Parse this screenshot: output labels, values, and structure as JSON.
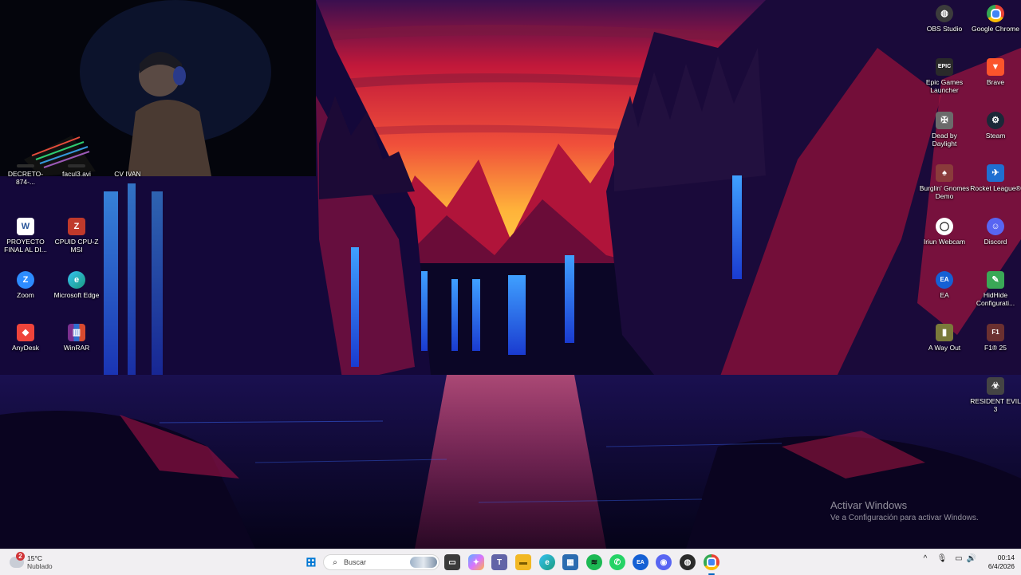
{
  "desktop": {
    "left_icons": [
      {
        "label": "DECRETO-874-...",
        "icon": "document-icon",
        "color": "#2d2d2d"
      },
      {
        "label": "facul3.avi",
        "icon": "video-file-icon",
        "color": "#2d2d2d"
      },
      {
        "label": "CV IVAN",
        "icon": "folder-icon",
        "color": "#2d2d2d"
      },
      {
        "label": "PROYECTO FINAL AL DI...",
        "icon": "word-document-icon",
        "color": "#2b579a"
      },
      {
        "label": "CPUID CPU-Z MSI",
        "icon": "cpuz-icon",
        "color": "#c0392b"
      },
      {
        "label": "Zoom",
        "icon": "zoom-icon",
        "color": "#2d8cff"
      },
      {
        "label": "Microsoft Edge",
        "icon": "edge-icon",
        "color": "#1a9c7f"
      },
      {
        "label": "AnyDesk",
        "icon": "anydesk-icon",
        "color": "#ef443b"
      },
      {
        "label": "WinRAR",
        "icon": "winrar-icon",
        "color": "#7b2f8f"
      }
    ],
    "right_icons": [
      {
        "label": "OBS Studio",
        "icon": "obs-icon",
        "color": "#3c3c3c"
      },
      {
        "label": "Google Chrome",
        "icon": "chrome-icon",
        "color": "#ea4335"
      },
      {
        "label": "Epic Games Launcher",
        "icon": "epic-games-icon",
        "color": "#2a2a2a"
      },
      {
        "label": "Brave",
        "icon": "brave-icon",
        "color": "#fb542b"
      },
      {
        "label": "Dead by Daylight",
        "icon": "dead-by-daylight-icon",
        "color": "#6b6b6b"
      },
      {
        "label": "Steam",
        "icon": "steam-icon",
        "color": "#1b2838"
      },
      {
        "label": "Burglin' Gnomes Demo",
        "icon": "burglin-gnomes-icon",
        "color": "#8a3b3b"
      },
      {
        "label": "Rocket League®",
        "icon": "rocket-league-icon",
        "color": "#1f6fd1"
      },
      {
        "label": "Iriun Webcam",
        "icon": "iriun-webcam-icon",
        "color": "#1e1e1e"
      },
      {
        "label": "Discord",
        "icon": "discord-icon",
        "color": "#5865f2"
      },
      {
        "label": "EA",
        "icon": "ea-icon",
        "color": "#1560d4"
      },
      {
        "label": "HidHide Configurati...",
        "icon": "hidhide-icon",
        "color": "#3aa856"
      },
      {
        "label": "A Way Out",
        "icon": "a-way-out-icon",
        "color": "#7a7a3a"
      },
      {
        "label": "F1® 25",
        "icon": "f1-25-icon",
        "color": "#6b3030"
      },
      {
        "label": "RESIDENT EVIL 3",
        "icon": "resident-evil-3-icon",
        "color": "#444444"
      }
    ]
  },
  "watermark": {
    "title": "Activar Windows",
    "subtitle": "Ve a Configuración para activar Windows."
  },
  "taskbar": {
    "weather": {
      "temp": "15°C",
      "condition": "Nublado",
      "badge": "2"
    },
    "search_placeholder": "Buscar",
    "pinned": [
      {
        "name": "windows-start-icon",
        "glyph": "⊞",
        "color": "#0078d4"
      },
      {
        "name": "task-view-icon",
        "glyph": "▭",
        "color": "#3b3b3b"
      },
      {
        "name": "copilot-icon",
        "glyph": "✦",
        "color": "#d874ff"
      },
      {
        "name": "teams-icon",
        "glyph": "T",
        "color": "#6264a7"
      },
      {
        "name": "file-explorer-icon",
        "glyph": "▬",
        "color": "#f2b824"
      },
      {
        "name": "edge-icon",
        "glyph": "e",
        "color": "#1a9c7f"
      },
      {
        "name": "microsoft-store-icon",
        "glyph": "▦",
        "color": "#2b6cb0"
      },
      {
        "name": "spotify-icon",
        "glyph": "≋",
        "color": "#1db954"
      },
      {
        "name": "whatsapp-icon",
        "glyph": "✆",
        "color": "#25d366"
      },
      {
        "name": "ea-app-icon",
        "glyph": "EA",
        "color": "#1560d4"
      },
      {
        "name": "discord-icon",
        "glyph": "◉",
        "color": "#5865f2"
      },
      {
        "name": "obs-icon",
        "glyph": "◍",
        "color": "#2b2b2b"
      },
      {
        "name": "chrome-icon",
        "glyph": "◎",
        "color": "#ea4335"
      }
    ],
    "tray": {
      "chevron": "^",
      "mic": "🎙",
      "network": "▭",
      "volume": "🔊"
    },
    "clock": {
      "time": "00:14",
      "date": "6/4/2026"
    }
  }
}
